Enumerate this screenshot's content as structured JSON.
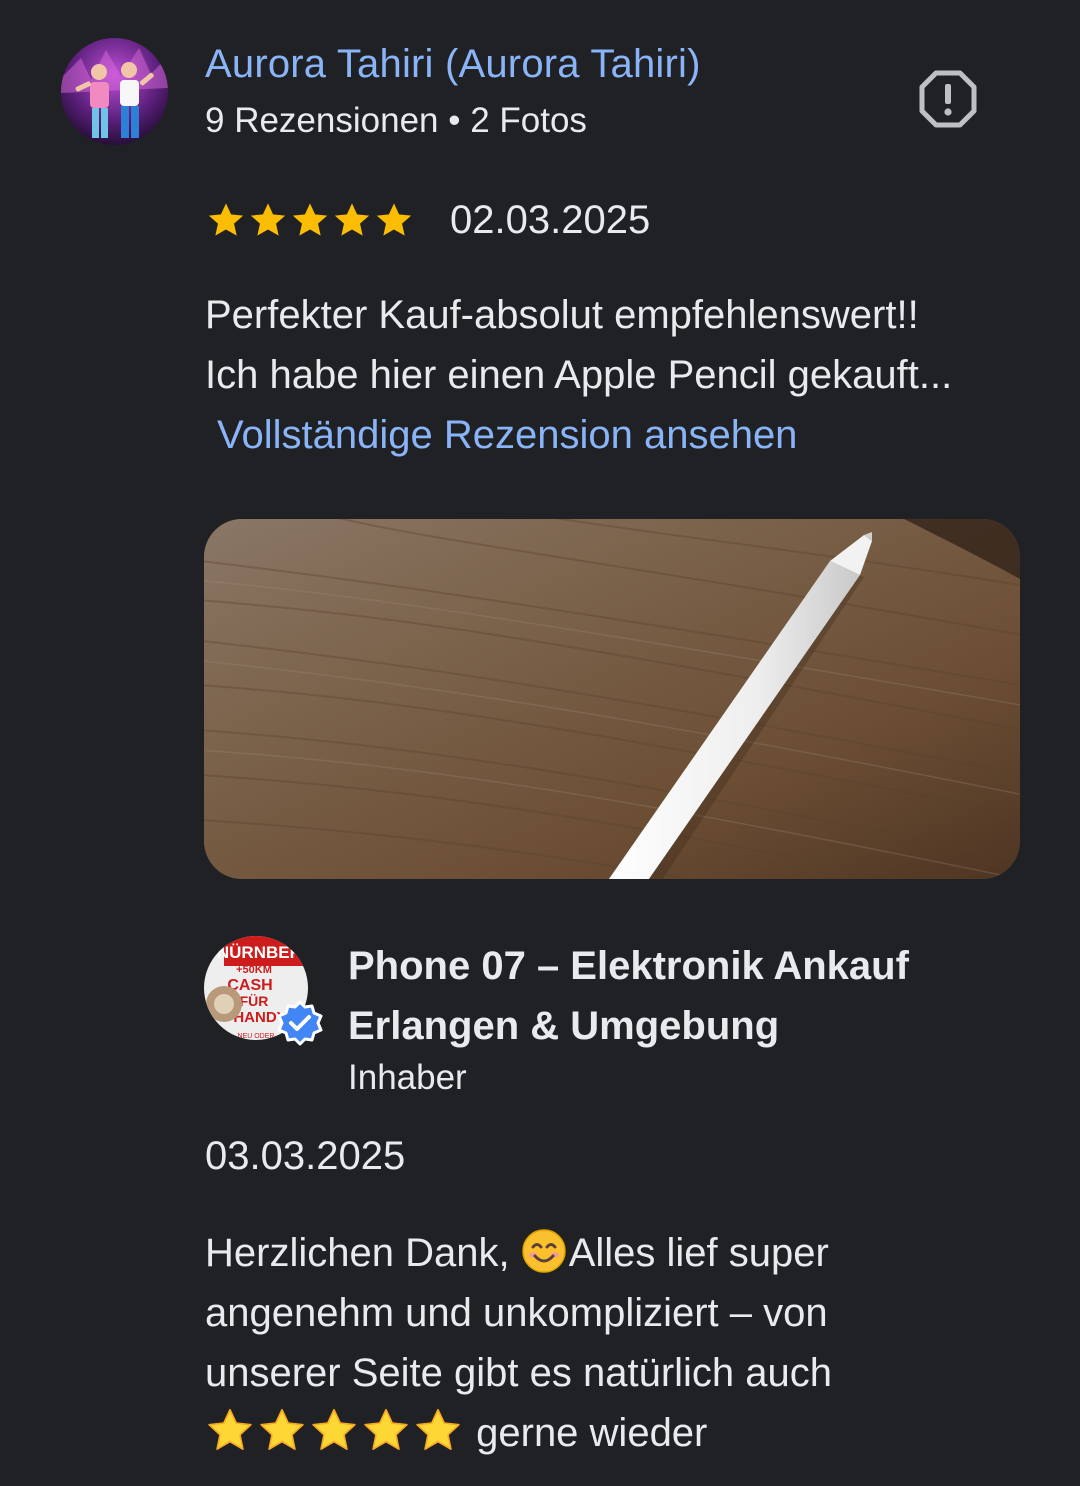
{
  "review": {
    "author_name": "Aurora Tahiri (Aurora Tahiri)",
    "author_meta": "9 Rezensionen • 2 Fotos",
    "rating": 5,
    "rating_max": 5,
    "date": "02.03.2025",
    "text_line_1": "Perfekter Kauf-absolut empfehlenswert!!",
    "text_line_2": "Ich habe hier einen Apple Pencil gekauft...",
    "more_link": "Vollständige Rezension ansehen",
    "star_color": "#fbbc04",
    "link_color": "#8ab4f8",
    "icons": {
      "report": "report-flag-icon",
      "star": "star-icon"
    }
  },
  "owner_reply": {
    "name_line_1": "Phone 07 – Elektronik Ankauf",
    "name_line_2": "Erlangen & Umgebung",
    "role": "Inhaber",
    "date": "03.03.2025",
    "text_line_1_a": "Herzlichen Dank, ",
    "text_line_1_b": "Alles lief super",
    "text_line_2": "angenehm und unkompliziert – von",
    "text_line_3": "unserer Seite gibt es natürlich auch",
    "text_line_4": "gerne wieder",
    "emoji_star_count": 5,
    "verified_color": "#4285f4",
    "logo_text": {
      "line_1": "NÜRNBERG",
      "line_2": "+50KM",
      "line_3": "CASH",
      "line_4": "FÜR",
      "line_5": "HANDY",
      "line_6": "NEU ODER"
    },
    "icons": {
      "smile": "smiling-face-emoji-icon",
      "star": "star-emoji-icon",
      "verified": "verified-badge-icon"
    }
  },
  "colors": {
    "background": "#202124",
    "text": "#e8eaed"
  }
}
